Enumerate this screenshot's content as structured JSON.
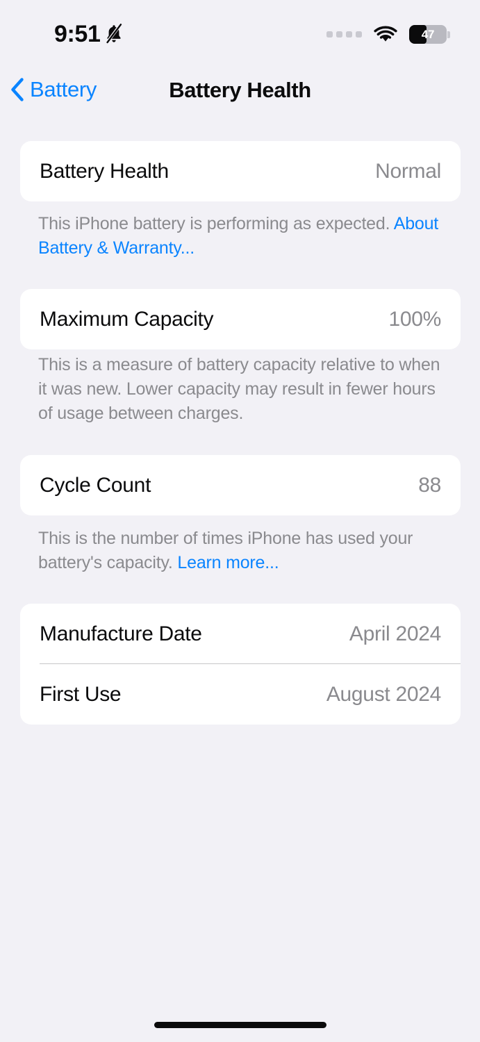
{
  "status_bar": {
    "time": "9:51",
    "silent_icon": "bell-slash-icon",
    "signal_icon": "cellular-dots-icon",
    "wifi_icon": "wifi-icon",
    "battery_percent": "47",
    "battery_level": 47
  },
  "nav": {
    "back_label": "Battery",
    "back_icon": "chevron-left-icon",
    "title": "Battery Health"
  },
  "sections": [
    {
      "rows": [
        {
          "label": "Battery Health",
          "value": "Normal"
        }
      ],
      "footer_text": "This iPhone battery is performing as expected. ",
      "footer_link": "About Battery & Warranty..."
    },
    {
      "rows": [
        {
          "label": "Maximum Capacity",
          "value": "100%"
        }
      ],
      "footer_text": "This is a measure of battery capacity relative to when it was new. Lower capacity may result in fewer hours of usage between charges.",
      "footer_link": ""
    },
    {
      "rows": [
        {
          "label": "Cycle Count",
          "value": "88"
        }
      ],
      "footer_text": "This is the number of times iPhone has used your battery's capacity. ",
      "footer_link": "Learn more..."
    },
    {
      "rows": [
        {
          "label": "Manufacture Date",
          "value": "April 2024"
        },
        {
          "label": "First Use",
          "value": "August 2024"
        }
      ],
      "footer_text": "",
      "footer_link": ""
    }
  ],
  "colors": {
    "background": "#F2F1F6",
    "card": "#FFFFFF",
    "accent_blue": "#0A84FF",
    "label": "#0B0B0C",
    "secondary": "#8A8A8E",
    "separator": "#C6C6C8"
  }
}
